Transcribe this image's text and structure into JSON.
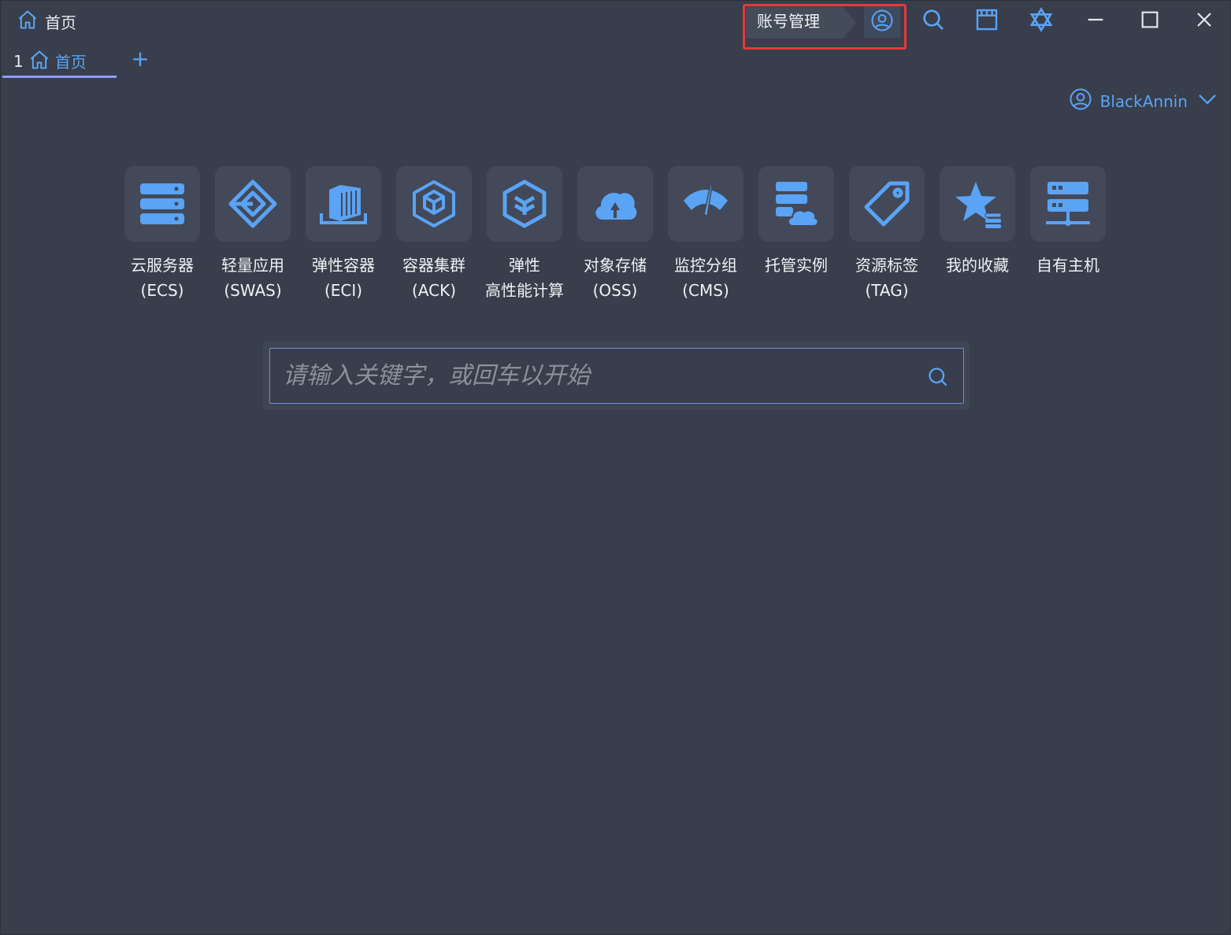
{
  "window": {
    "title": "首页"
  },
  "titlebar": {
    "account_tooltip": "账号管理",
    "icons": [
      "account-icon",
      "search-icon",
      "window-icon",
      "logo-icon",
      "minimize-icon",
      "maximize-icon",
      "close-icon"
    ]
  },
  "tabs": [
    {
      "index": "1",
      "label": "首页"
    }
  ],
  "add_tab": "+",
  "user": {
    "name": "BlackAnnin"
  },
  "services": [
    {
      "name": "云服务器",
      "sub": "(ECS)"
    },
    {
      "name": "轻量应用",
      "sub": "(SWAS)"
    },
    {
      "name": "弹性容器",
      "sub": "(ECI)"
    },
    {
      "name": "容器集群",
      "sub": "(ACK)"
    },
    {
      "name": "弹性",
      "sub": "高性能计算"
    },
    {
      "name": "对象存储",
      "sub": "(OSS)"
    },
    {
      "name": "监控分组",
      "sub": "(CMS)"
    },
    {
      "name": "托管实例",
      "sub": ""
    },
    {
      "name": "资源标签",
      "sub": "(TAG)"
    },
    {
      "name": "我的收藏",
      "sub": ""
    },
    {
      "name": "自有主机",
      "sub": ""
    }
  ],
  "search": {
    "placeholder": "请输入关键字，或回车以开始",
    "value": ""
  },
  "colors": {
    "accent": "#5aa3f5",
    "background": "#383e4b",
    "tile": "#434958",
    "highlight": "#e8383b",
    "tab_underline": "#8f9cf5"
  }
}
